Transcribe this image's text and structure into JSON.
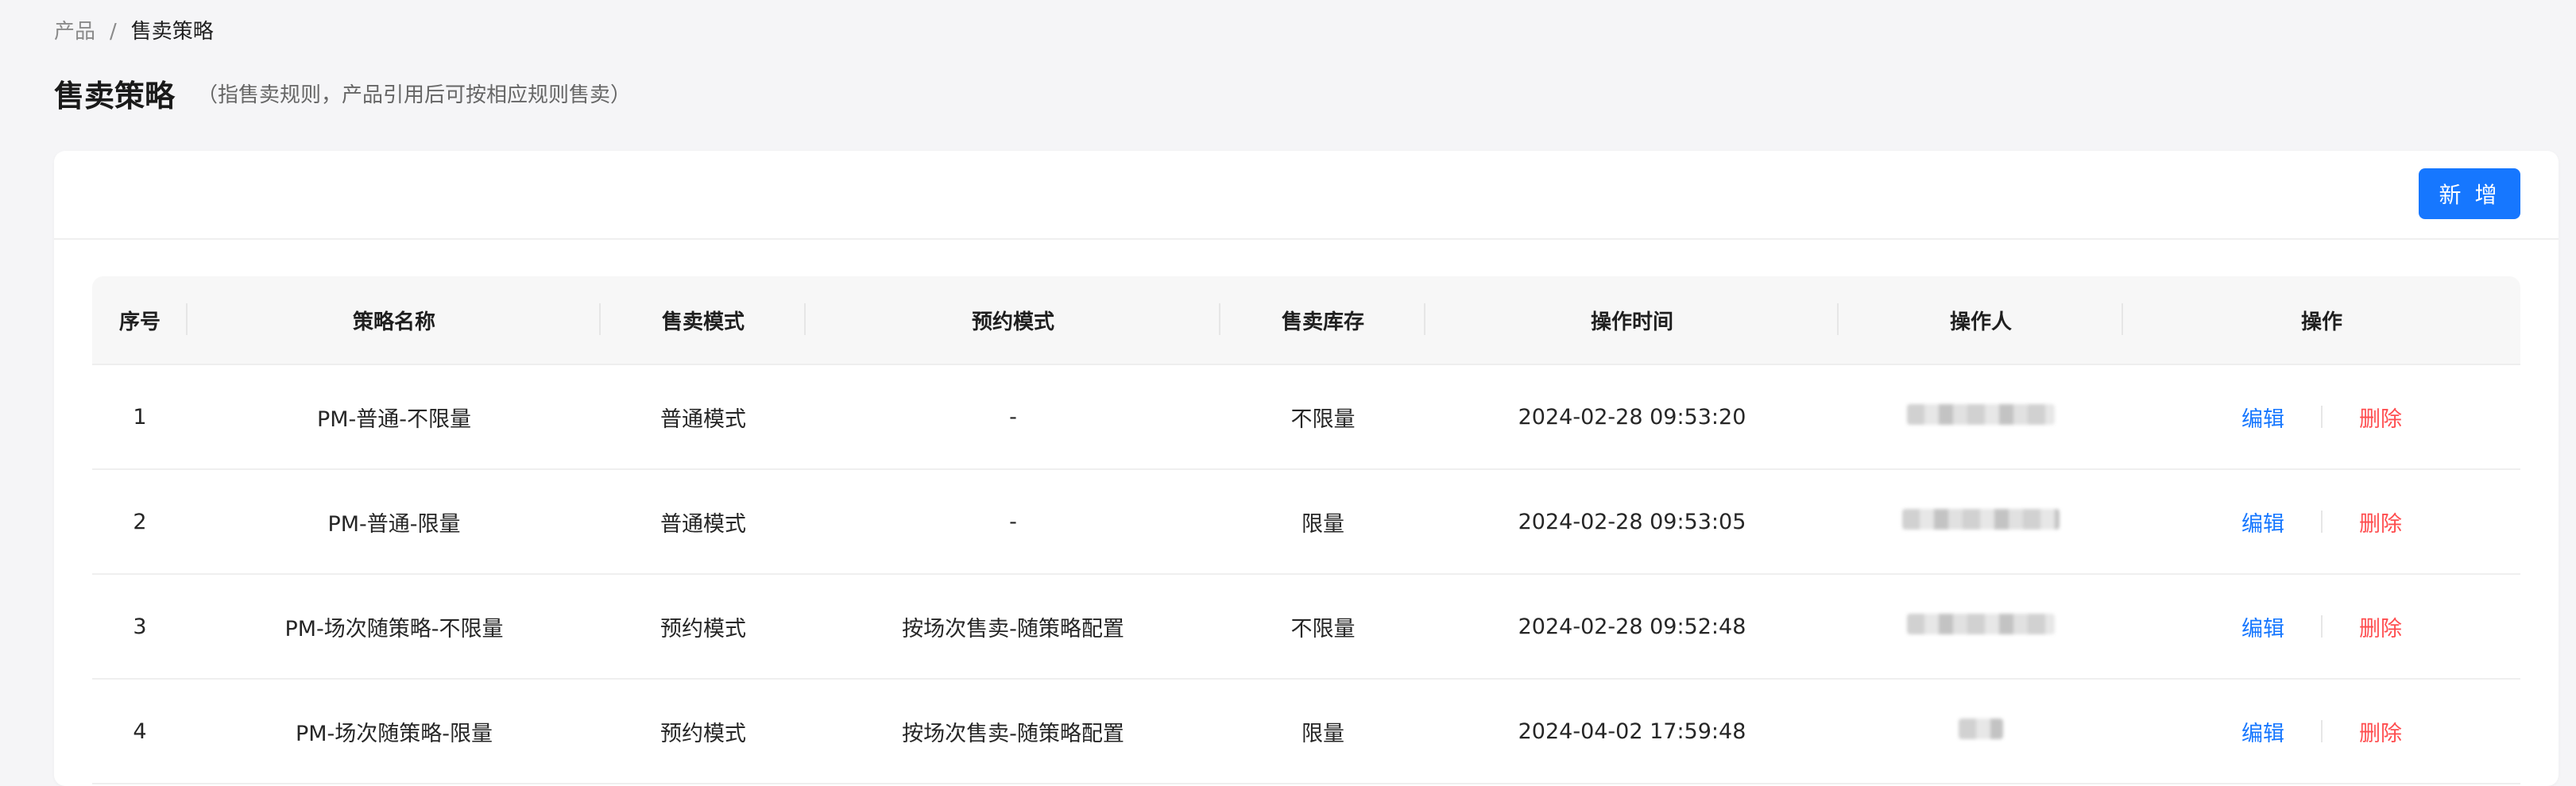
{
  "breadcrumb": {
    "root": "产品",
    "separator": "/",
    "current": "售卖策略"
  },
  "header": {
    "title": "售卖策略",
    "subtitle": "（指售卖规则，产品引用后可按相应规则售卖）"
  },
  "toolbar": {
    "add_label": "新 增"
  },
  "table": {
    "columns": [
      "序号",
      "策略名称",
      "售卖模式",
      "预约模式",
      "售卖库存",
      "操作时间",
      "操作人",
      "操作"
    ],
    "rows": [
      {
        "index": "1",
        "name": "PM-普通-不限量",
        "sale_mode": "普通模式",
        "booking_mode": "-",
        "stock": "不限量",
        "time": "2024-02-28 09:53:20",
        "edit": "编辑",
        "delete": "删除"
      },
      {
        "index": "2",
        "name": "PM-普通-限量",
        "sale_mode": "普通模式",
        "booking_mode": "-",
        "stock": "限量",
        "time": "2024-02-28 09:53:05",
        "edit": "编辑",
        "delete": "删除"
      },
      {
        "index": "3",
        "name": "PM-场次随策略-不限量",
        "sale_mode": "预约模式",
        "booking_mode": "按场次售卖-随策略配置",
        "stock": "不限量",
        "time": "2024-02-28 09:52:48",
        "edit": "编辑",
        "delete": "删除"
      },
      {
        "index": "4",
        "name": "PM-场次随策略-限量",
        "sale_mode": "预约模式",
        "booking_mode": "按场次售卖-随策略配置",
        "stock": "限量",
        "time": "2024-04-02 17:59:48",
        "edit": "编辑",
        "delete": "删除"
      }
    ]
  },
  "colors": {
    "primary": "#1677ff",
    "danger": "#ff4d4f"
  }
}
